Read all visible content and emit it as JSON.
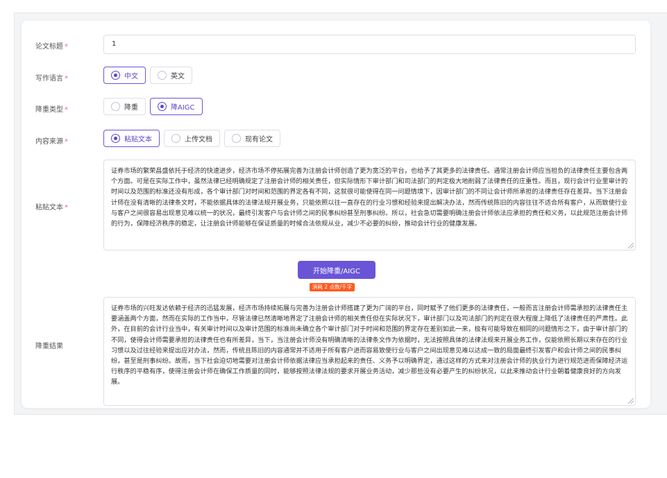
{
  "form": {
    "title": {
      "label": "论文标题",
      "value": "1"
    },
    "language": {
      "label": "写作语言",
      "options": [
        {
          "label": "中文",
          "selected": true
        },
        {
          "label": "英文",
          "selected": false
        }
      ]
    },
    "reduce_type": {
      "label": "降重类型",
      "options": [
        {
          "label": "降重",
          "selected": false
        },
        {
          "label": "降AIGC",
          "selected": true
        }
      ]
    },
    "content_source": {
      "label": "内容来源",
      "options": [
        {
          "label": "粘贴文本",
          "selected": true
        },
        {
          "label": "上传文档",
          "selected": false
        },
        {
          "label": "现有论文",
          "selected": false
        }
      ]
    },
    "paste_text": {
      "label": "粘贴文本",
      "value": "证券市场的繁荣昌盛依托于经济的快速进步，经济市场不停拓展完善为注册会计师创造了更为宽泛的平台，也给予了其更多的法律责任。通常注册会计师应当担负的法律责任主要包含两个方面。可是在实际工作中，虽然法律已经明确规定了注册会计师的相关责任，但实际情形下审计部门和司法部门的判定极大地削弱了法律责任的庄重性。而且，现行会计行业里审计的时间以及范围的标准还没有形成，各个审计部门对时间和范围的界定各有不同，这就很可能使得在同一问题情境下，因审计部门的不同让会计师所承担的法律责任存在差异。当下注册会计师在没有清晰的法律条文时，不能依据具体的法律法规开展业务，只能依照以往一直存在的行业习惯和经验来提出解决办法，然而传统陈旧的内容往往不适合所有客户，从而致使行业与客户之间很容易出现意见难以统一的状况，最终引发客户与会计师之间的民事纠纷甚至刑事纠纷。所以，社会急切需要明确注册会计师依法应承担的责任和义务，以此规范注册会计师的行为，保障经济秩序的稳定，让注册会计师能够在保证质量的时候合法依规从业，减少不必要的纠纷，推动会计行业的健康发展。"
    },
    "submit_label": "开始降重/AIGC",
    "cost_label": "消耗 2 点数/千字",
    "result": {
      "label": "降重结果",
      "value": "证券市场的兴旺发达依赖于经济的迅猛发展，经济市场持续拓展与完善为注册会计师搭建了更为广阔的平台，同时赋予了他们更多的法律责任，一般而言注册会计师需承担的法律责任主要涵盖两个方面，然而在实际的工作当中，尽管法律已然清晰地界定了注册会计师的相关责任但在实际状况下，审计部门以及司法部门的判定在很大程度上降低了法律责任的严肃性。此外，在目前的会计行业当中，有关审计时间以及审计范围的标准尚未确立各个审计部门对于时间和范围的界定存在差别如此一来，极有可能导致在相同的问题情形之下，由于审计部门的不同，使得会计师需要承担的法律责任也有所差异，当下，当注册会计师没有明确清晰的法律条文作为依据时，无法按照具体的法律法规来开展业务工作，仅能依照长期以来存在的行业习惯以及过往经验来提出应对办法，然而，传统且陈旧的内容通常并不适用于所有客户进而容易致使行业与客户之间出现意见难以达成一致的局面最终引发客户和会计师之间的民事纠纷，甚至是刑事纠纷。故而，当下社会迫切地需要对注册会计师依据法律应当承担起来的责任、义务予以明确界定，通过这样的方式来对注册会计师的执业行为进行规范进而保障经济运行秩序的平稳有序，使得注册会计师在确保工作质量的同时，能够按照法律法规的要求开展业务活动，减少那些没有必要产生的纠纷状况，以此来推动会计行业朝着健康良好的方向发展。"
    },
    "required_mark": "*"
  },
  "colors": {
    "accent": "#6a55d6",
    "required": "#f56c6c",
    "badge": "#ff5a1f"
  }
}
